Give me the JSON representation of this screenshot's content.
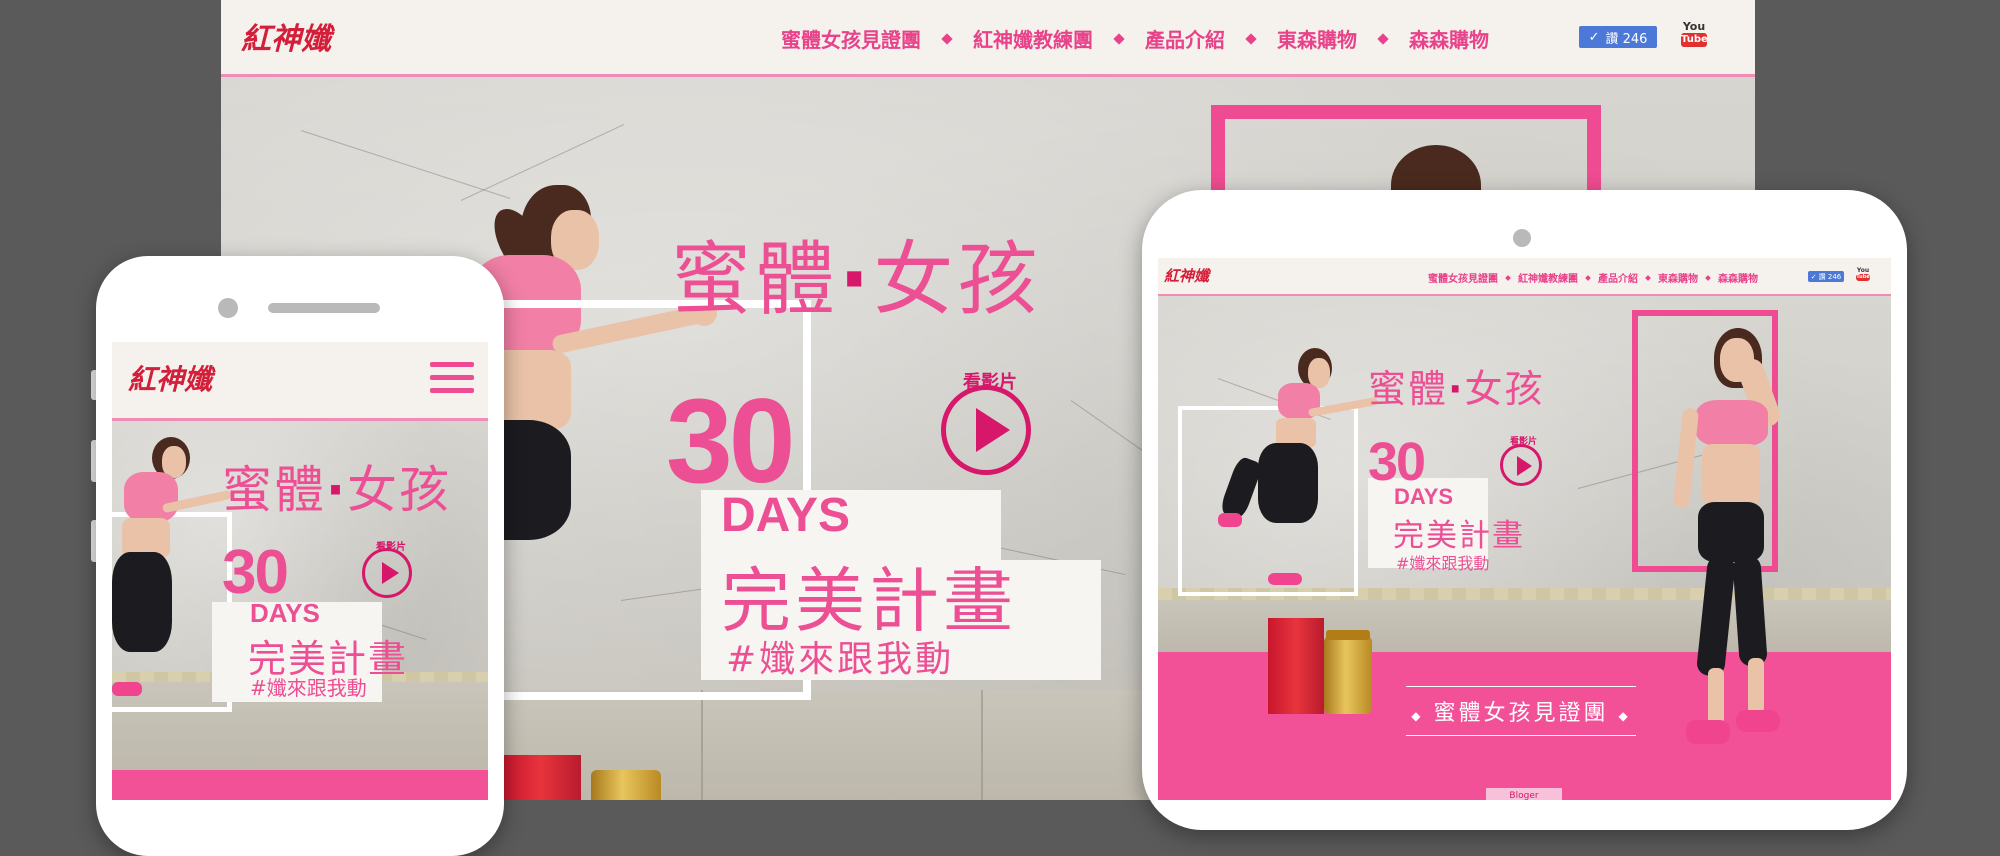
{
  "brand": {
    "logo_text": "紅神孅"
  },
  "nav": {
    "items": [
      "蜜體女孩見證團",
      "紅神孅教練團",
      "產品介紹",
      "東森購物",
      "森森購物"
    ],
    "like_label": "讚 246",
    "youtube_top": "You",
    "youtube_bottom": "Tube"
  },
  "hero": {
    "title_left": "蜜體",
    "title_dot": "·",
    "title_right": "女孩",
    "days_number": "30",
    "days_label": "DAYS",
    "plan": "完美計畫",
    "hashtag": "#孅來跟我動",
    "video_label": "看影片"
  },
  "tablet": {
    "section_title": "蜜體女孩見證團",
    "bloger_tab": "Bloger"
  },
  "colors": {
    "accent": "#ec4f93",
    "deep": "#d6176a",
    "bg": "#5a5a5a"
  },
  "icons": [
    "check-icon",
    "youtube-icon",
    "play-icon",
    "hamburger-menu-icon",
    "camera-icon",
    "speaker-icon"
  ]
}
